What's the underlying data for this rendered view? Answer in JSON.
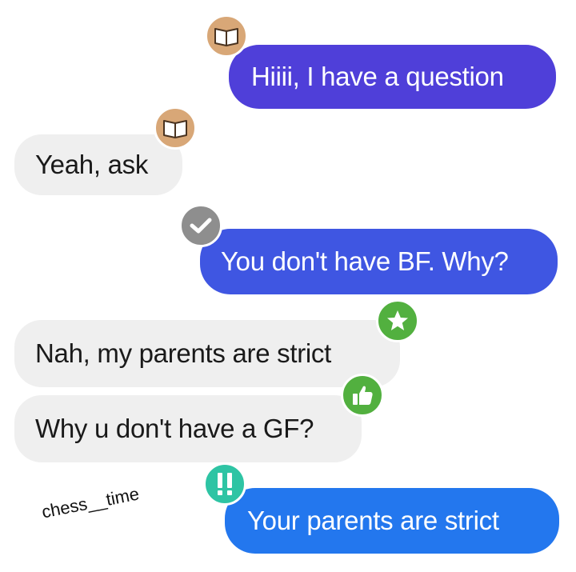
{
  "colors": {
    "sent_bubble_1": "#4f3fd9",
    "sent_bubble_2": "#3f56e2",
    "sent_bubble_3": "#2377ee",
    "received_bubble": "#efefef",
    "reaction_book": "#d8a777",
    "reaction_check": "#8e8e8e",
    "reaction_star": "#52b03f",
    "reaction_like": "#52b03f",
    "reaction_exclaim": "#2ec4a4"
  },
  "messages": [
    {
      "id": "m1",
      "direction": "sent",
      "text": "Hiiii, I have a question",
      "reaction_icon": "open-book-icon"
    },
    {
      "id": "m2",
      "direction": "received",
      "text": "Yeah, ask",
      "reaction_icon": "open-book-icon"
    },
    {
      "id": "m3",
      "direction": "sent",
      "text": "You don't have BF. Why?",
      "reaction_icon": "checkmark-icon"
    },
    {
      "id": "m4",
      "direction": "received",
      "text": "Nah, my parents are strict",
      "reaction_icon": "star-icon"
    },
    {
      "id": "m5",
      "direction": "received",
      "text": "Why u don't have a GF?",
      "reaction_icon": "thumbs-up-icon"
    },
    {
      "id": "m6",
      "direction": "sent",
      "text": "Your parents are strict",
      "reaction_icon": "double-exclamation-icon"
    }
  ],
  "watermark": "chess__time"
}
